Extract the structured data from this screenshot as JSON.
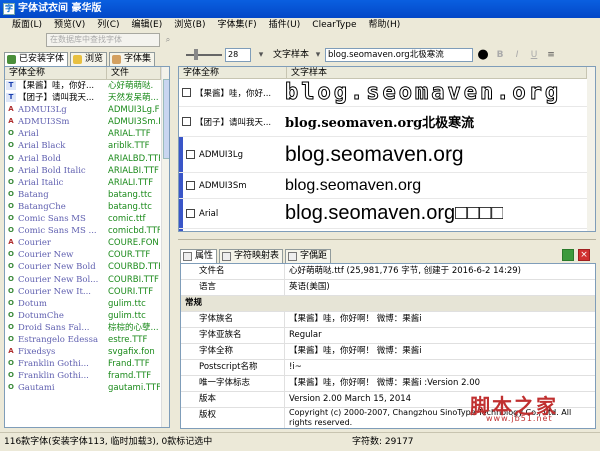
{
  "window": {
    "title": "字体试衣间 豪华版"
  },
  "menu": [
    "版面(L)",
    "预览(V)",
    "列(C)",
    "编辑(E)",
    "浏览(B)",
    "字体集(F)",
    "插件(U)",
    "ClearType",
    "帮助(H)"
  ],
  "search": {
    "placeholder": "在数据库中查找字体",
    "button_icon": "search-icon"
  },
  "left_tabs": [
    "已安装字体",
    "浏览",
    "字体集"
  ],
  "left_table": {
    "headers": [
      "字体全称",
      "文件"
    ],
    "rows": [
      {
        "name": "【果酱】哇，你好...",
        "file": "心好萌萌哒.",
        "icon": "T"
      },
      {
        "name": "【团子】请叫我天...",
        "file": "天然发呆萌...",
        "icon": "T"
      },
      {
        "name": "ADMUI3Lg",
        "file": "ADMUI3Lg.FON",
        "icon": "A"
      },
      {
        "name": "ADMUI3Sm",
        "file": "ADMUI3Sm.FON",
        "icon": "A"
      },
      {
        "name": "Arial",
        "file": "ARIAL.TTF",
        "icon": "O"
      },
      {
        "name": "Arial Black",
        "file": "ariblk.TTF",
        "icon": "O"
      },
      {
        "name": "Arial Bold",
        "file": "ARIALBD.TTF",
        "icon": "O"
      },
      {
        "name": "Arial Bold Italic",
        "file": "ARIALBI.TTF",
        "icon": "O"
      },
      {
        "name": "Arial Italic",
        "file": "ARIALI.TTF",
        "icon": "O"
      },
      {
        "name": "Batang",
        "file": "batang.ttc",
        "icon": "O"
      },
      {
        "name": "BatangChe",
        "file": "batang.ttc",
        "icon": "O"
      },
      {
        "name": "Comic Sans MS",
        "file": "comic.ttf",
        "icon": "O"
      },
      {
        "name": "Comic Sans MS ...",
        "file": "comicbd.TTF",
        "icon": "O"
      },
      {
        "name": "Courier",
        "file": "COURE.FON",
        "icon": "A"
      },
      {
        "name": "Courier New",
        "file": "COUR.TTF",
        "icon": "O"
      },
      {
        "name": "Courier New Bold",
        "file": "COURBD.TTF",
        "icon": "O"
      },
      {
        "name": "Courier New Bol...",
        "file": "COURBI.TTF",
        "icon": "O"
      },
      {
        "name": "Courier New It...",
        "file": "COURI.TTF",
        "icon": "O"
      },
      {
        "name": "Dotum",
        "file": "gulim.ttc",
        "icon": "O"
      },
      {
        "name": "DotumChe",
        "file": "gulim.ttc",
        "icon": "O"
      },
      {
        "name": "Droid Sans Fal...",
        "file": "棕棕的心孽...",
        "icon": "O"
      },
      {
        "name": "Estrangelo Edessa",
        "file": "estre.TTF",
        "icon": "O"
      },
      {
        "name": "Fixedsys",
        "file": "svgafix.fon",
        "icon": "A"
      },
      {
        "name": "Franklin Gothi...",
        "file": "Frand.TTF",
        "icon": "O"
      },
      {
        "name": "Franklin Gothi...",
        "file": "framd.TTF",
        "icon": "O"
      },
      {
        "name": "Gautami",
        "file": "gautami.TTF",
        "icon": "O"
      }
    ]
  },
  "toolbar": {
    "size": "28",
    "sample_label": "文字样本",
    "sample_text": "blog.seomaven.org北极寒流",
    "bold": "B",
    "italic": "I",
    "underline": "U"
  },
  "preview": {
    "headers": [
      "字体全称",
      "文字样本"
    ],
    "rows": [
      {
        "name": "【果酱】哇，你好...",
        "sample": "blog.seomaven.org"
      },
      {
        "name": "【团子】请叫我天...",
        "sample": "blog.seomaven.org北极寒流"
      },
      {
        "name": "ADMUI3Lg",
        "sample": "blog.seomaven.org"
      },
      {
        "name": "ADMUI3Sm",
        "sample": "blog.seomaven.org"
      },
      {
        "name": "Arial",
        "sample": "blog.seomaven.org□□□□"
      },
      {
        "name": "",
        "sample": ""
      }
    ]
  },
  "bottom_tabs": [
    "属性",
    "字符映射表",
    "字偶距"
  ],
  "properties": [
    {
      "key": "文件名",
      "value": "心好萌萌哒.ttf (25,981,776 字节, 创建于 2016-6-2 14:29)"
    },
    {
      "key": "语言",
      "value": "英语(美国)"
    },
    {
      "key": "常规",
      "value": "",
      "section": true
    },
    {
      "key": "字体族名",
      "value": "【果酱】哇，你好啊！    微博：果酱i"
    },
    {
      "key": "字体亚族名",
      "value": "Regular"
    },
    {
      "key": "字体全称",
      "value": "【果酱】哇，你好啊！    微博：果酱i"
    },
    {
      "key": "Postscript名称",
      "value": "!i~"
    },
    {
      "key": "唯一字体标志",
      "value": "【果酱】哇，你好啊！    微博：果酱i :Version 2.00"
    },
    {
      "key": "版本",
      "value": "Version 2.00 March 15, 2014"
    },
    {
      "key": "版权",
      "value": "Copyright (c) 2000-2007, Changzhou SinoType Technology Co., Ltd. All rights reserved.",
      "tall": true
    }
  ],
  "status": {
    "left": "116款字体(安装字体113, 临时加载3), 0款标记选中",
    "right": "字符数: 29177"
  },
  "watermark": {
    "text": "脚本之家",
    "sub": "www.jb51.net"
  },
  "colors": {
    "titlebar": "#0347c7",
    "filegreen": "#1a8a1a",
    "rowbar": "#3a56c8"
  }
}
